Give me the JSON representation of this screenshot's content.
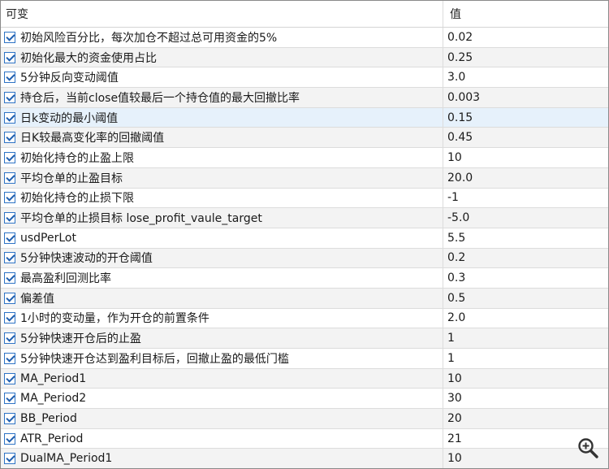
{
  "header": {
    "name_label": "可变",
    "value_label": "值"
  },
  "rows": [
    {
      "name": "初始风险百分比，每次加仓不超过总可用资金的5%",
      "value": "0.02",
      "checked": true
    },
    {
      "name": "初始化最大的资金使用占比",
      "value": "0.25",
      "checked": true
    },
    {
      "name": "5分钟反向变动阈值",
      "value": "3.0",
      "checked": true
    },
    {
      "name": "持仓后，当前close值较最后一个持仓值的最大回撤比率",
      "value": "0.003",
      "checked": true
    },
    {
      "name": "日k变动的最小阈值",
      "value": "0.15",
      "checked": true,
      "selected": true
    },
    {
      "name": "日K较最高变化率的回撤阈值",
      "value": "0.45",
      "checked": true
    },
    {
      "name": "初始化持仓的止盈上限",
      "value": "10",
      "checked": true
    },
    {
      "name": "平均仓单的止盈目标",
      "value": "20.0",
      "checked": true
    },
    {
      "name": "初始化持仓的止损下限",
      "value": "-1",
      "checked": true
    },
    {
      "name": "平均仓单的止损目标  lose_profit_vaule_target",
      "value": "-5.0",
      "checked": true
    },
    {
      "name": "usdPerLot",
      "value": "5.5",
      "checked": true
    },
    {
      "name": "5分钟快速波动的开仓阈值",
      "value": "0.2",
      "checked": true
    },
    {
      "name": "最高盈利回测比率",
      "value": "0.3",
      "checked": true
    },
    {
      "name": "偏差值",
      "value": "0.5",
      "checked": true
    },
    {
      "name": "1小时的变动量，作为开仓的前置条件",
      "value": "2.0",
      "checked": true
    },
    {
      "name": "5分钟快速开仓后的止盈",
      "value": "1",
      "checked": true
    },
    {
      "name": "5分钟快速开仓达到盈利目标后，回撤止盈的最低门槛",
      "value": "1",
      "checked": true
    },
    {
      "name": "MA_Period1",
      "value": "10",
      "checked": true
    },
    {
      "name": "MA_Period2",
      "value": "30",
      "checked": true
    },
    {
      "name": "BB_Period",
      "value": "20",
      "checked": true
    },
    {
      "name": "ATR_Period",
      "value": "21",
      "checked": true
    },
    {
      "name": "DualMA_Period1",
      "value": "10",
      "checked": true
    }
  ],
  "icons": {
    "zoom": "zoom-in-icon",
    "checkbox": "checkbox-checked-icon"
  },
  "colors": {
    "selected_row": "#e6f1fb",
    "alt_row": "#f3f3f3",
    "checkbox_border": "#2e73c5"
  }
}
